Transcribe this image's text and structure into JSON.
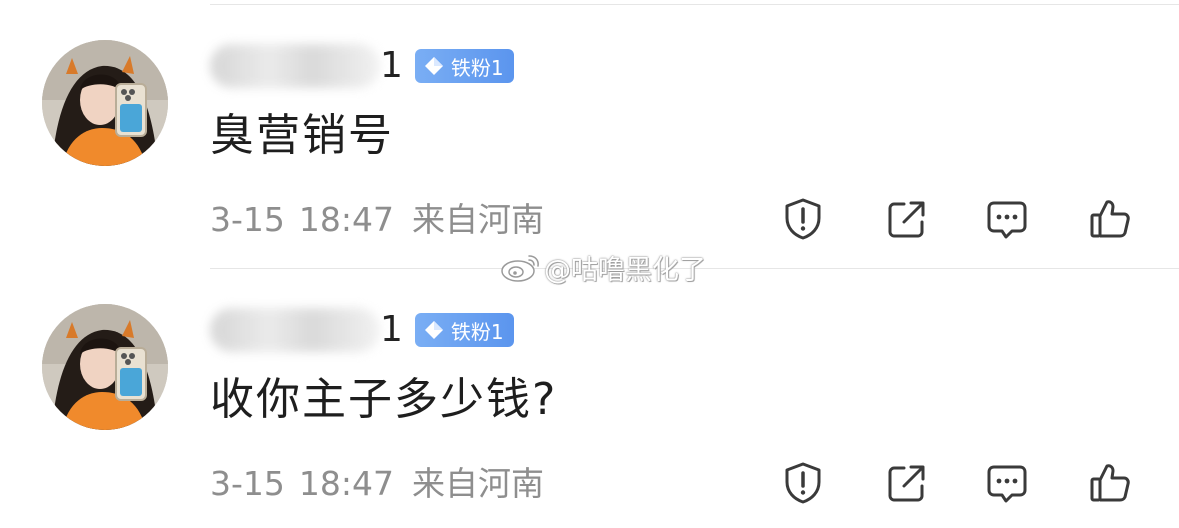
{
  "comments": [
    {
      "username_suffix": "1",
      "badge": "铁粉1",
      "text": "臭营销号",
      "date": "3-15",
      "time": "18:47",
      "location": "来自河南"
    },
    {
      "username_suffix": "1",
      "badge": "铁粉1",
      "text": "收你主子多少钱?",
      "date": "3-15",
      "time": "18:47",
      "location": "来自河南"
    }
  ],
  "watermark": {
    "text": "@咕噜黑化了",
    "icon": "weibo-logo-icon"
  },
  "icons": {
    "report": "shield-exclamation-icon",
    "share": "share-icon",
    "reply": "comment-bubble-icon",
    "like": "thumbs-up-icon",
    "badge": "diamond-icon"
  },
  "colors": {
    "badge_bg": "#6aa2f1",
    "meta_text": "#8e8e8e",
    "icon_stroke": "#3a3a3a",
    "divider": "#e6e6e6"
  }
}
